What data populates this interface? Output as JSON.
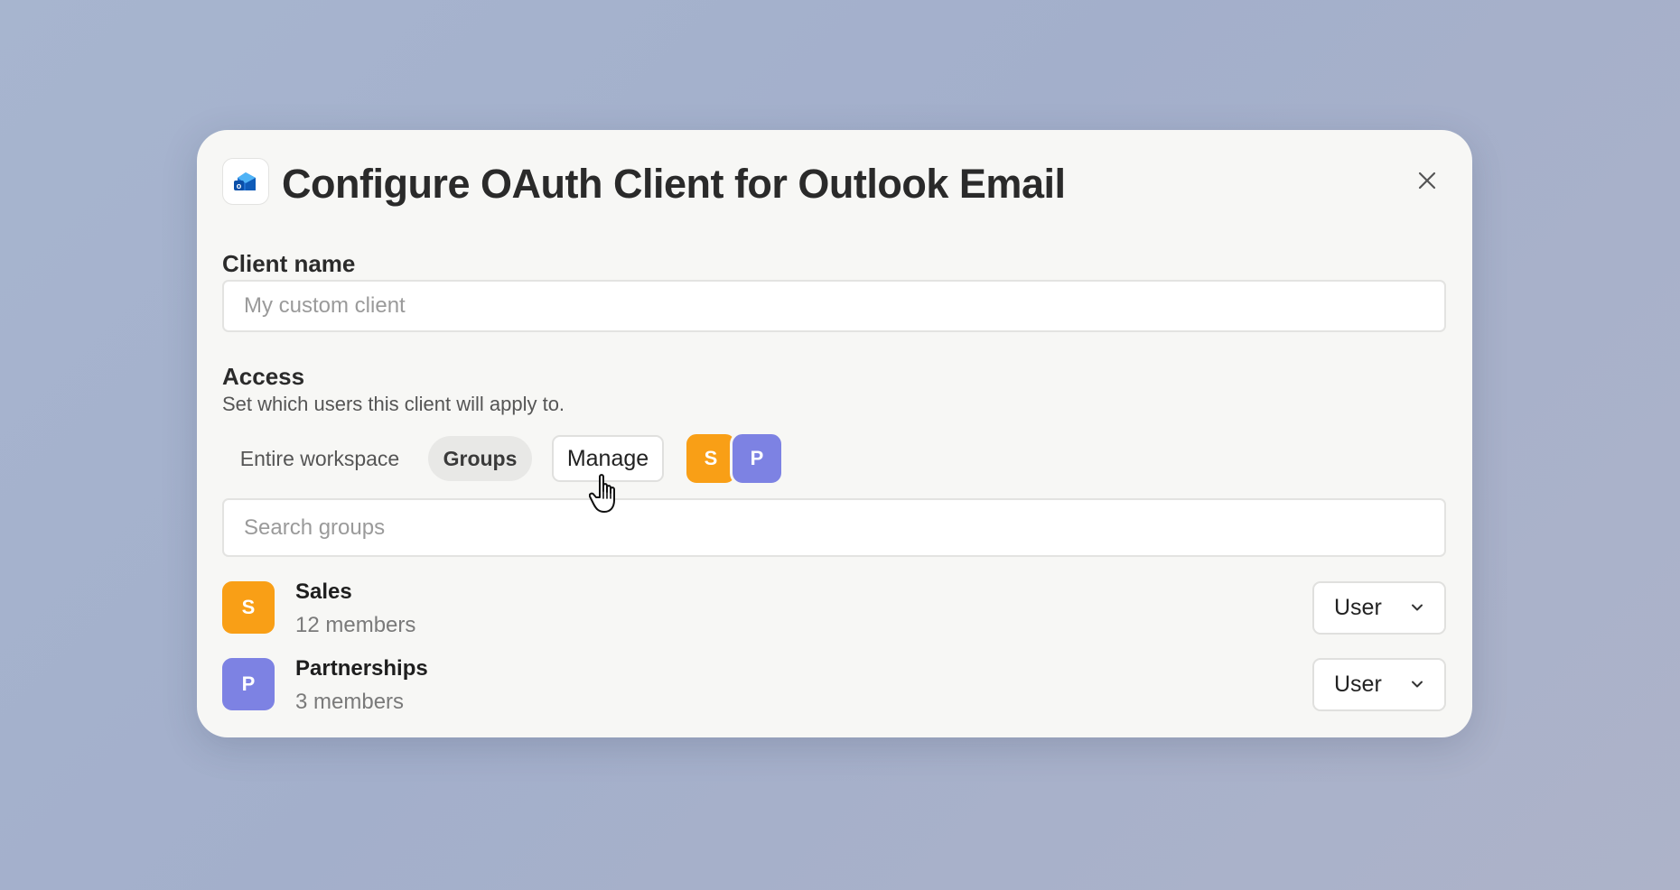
{
  "modal": {
    "title": "Configure OAuth Client for Outlook Email",
    "app_icon": "outlook-icon",
    "close_icon": "close-icon"
  },
  "client_name": {
    "label": "Client name",
    "placeholder": "My custom client",
    "value": ""
  },
  "access": {
    "label": "Access",
    "description": "Set which users this client will apply to.",
    "options": [
      "Entire workspace",
      "Groups"
    ],
    "selected": "Groups",
    "manage_label": "Manage",
    "selected_avatars": [
      "S",
      "P"
    ]
  },
  "search": {
    "placeholder": "Search groups",
    "value": ""
  },
  "groups": [
    {
      "initial": "S",
      "name": "Sales",
      "members": "12 members",
      "role": "User",
      "color": "#f99f16"
    },
    {
      "initial": "P",
      "name": "Partnerships",
      "members": "3 members",
      "role": "User",
      "color": "#7d82e3"
    }
  ],
  "colors": {
    "sales": "#f99f16",
    "partnerships": "#7d82e3",
    "modal_bg": "#f7f7f5"
  }
}
